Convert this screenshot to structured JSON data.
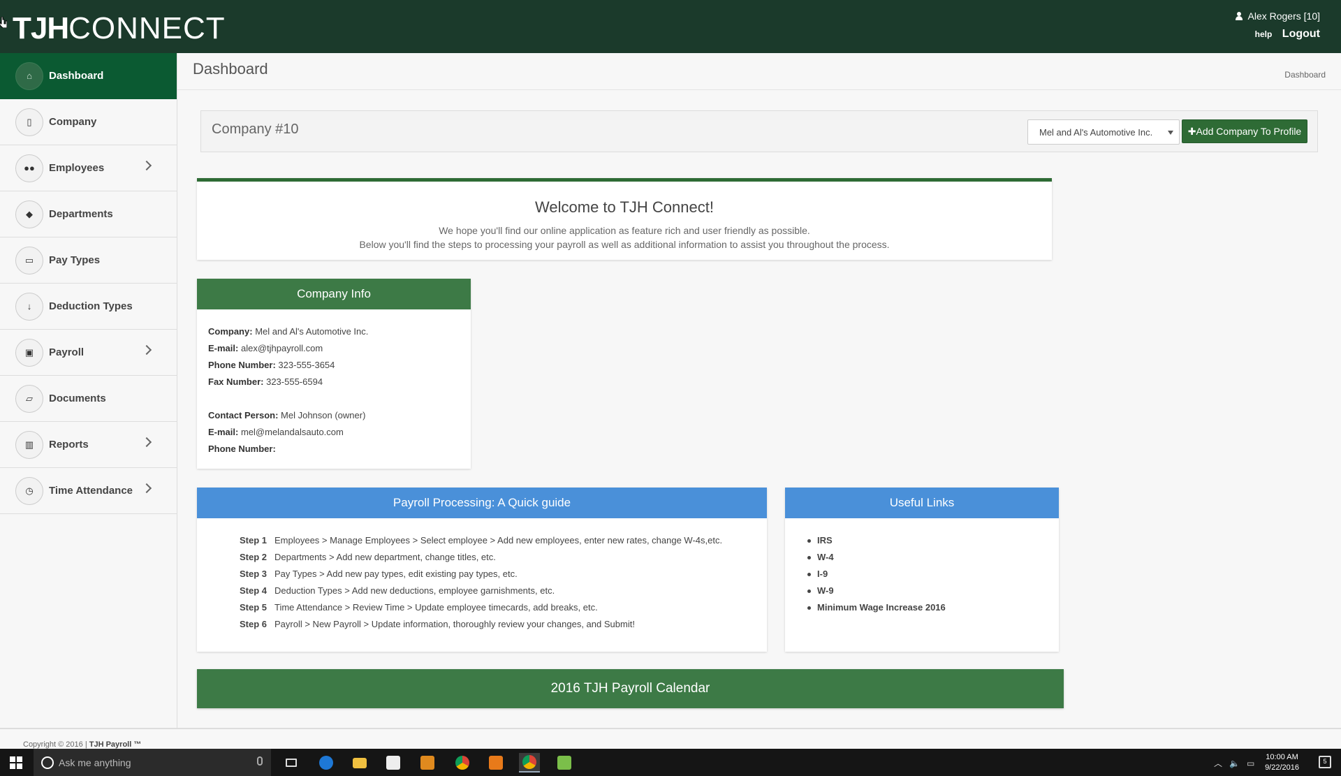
{
  "header": {
    "logo_bold": "TJH",
    "logo_light": "CONNECT",
    "user_name": "Alex Rogers [10]",
    "help_label": "help",
    "logout_label": "Logout"
  },
  "sidebar": {
    "items": [
      {
        "label": "Dashboard",
        "icon": "home-icon",
        "active": true
      },
      {
        "label": "Company",
        "icon": "building-icon"
      },
      {
        "label": "Employees",
        "icon": "users-icon",
        "has_submenu": true
      },
      {
        "label": "Departments",
        "icon": "tags-icon"
      },
      {
        "label": "Pay Types",
        "icon": "credit-card-icon"
      },
      {
        "label": "Deduction Types",
        "icon": "arrow-down-icon"
      },
      {
        "label": "Payroll",
        "icon": "money-icon",
        "has_submenu": true
      },
      {
        "label": "Documents",
        "icon": "folder-open-icon"
      },
      {
        "label": "Reports",
        "icon": "bar-chart-icon",
        "has_submenu": true
      },
      {
        "label": "Time Attendance",
        "icon": "clock-icon",
        "has_submenu": true
      }
    ]
  },
  "page": {
    "title": "Dashboard",
    "breadcrumb": "Dashboard"
  },
  "company_bar": {
    "title": "Company #10",
    "selected_company": "Mel and Al's Automotive Inc.",
    "add_button_label": "Add Company To Profile"
  },
  "welcome": {
    "heading": "Welcome to TJH Connect!",
    "line1": "We hope you'll find our online application as feature rich and user friendly as possible.",
    "line2": "Below you'll find the steps to processing your payroll as well as additional information to assist you throughout the process."
  },
  "company_info": {
    "title": "Company Info",
    "company_label": "Company:",
    "company_value": "Mel and Al's Automotive Inc.",
    "email_label": "E-mail:",
    "email_value": "alex@tjhpayroll.com",
    "phone_label": "Phone Number:",
    "phone_value": "323-555-3654",
    "fax_label": "Fax Number:",
    "fax_value": "323-555-6594",
    "contact_label": "Contact Person:",
    "contact_value": "Mel Johnson (owner)",
    "contact_email_label": "E-mail:",
    "contact_email_value": "mel@melandalsauto.com",
    "contact_phone_label": "Phone Number:",
    "contact_phone_value": ""
  },
  "guide": {
    "title": "Payroll Processing: A Quick guide",
    "steps": [
      {
        "step": "Step 1",
        "text": "Employees > Manage Employees > Select employee > Add new employees, enter new rates, change W-4s,etc."
      },
      {
        "step": "Step 2",
        "text": "Departments > Add new department, change titles, etc."
      },
      {
        "step": "Step 3",
        "text": "Pay Types > Add new pay types, edit existing pay types, etc."
      },
      {
        "step": "Step 4",
        "text": "Deduction Types > Add new deductions, employee garnishments, etc."
      },
      {
        "step": "Step 5",
        "text": "Time Attendance > Review Time > Update employee timecards, add breaks, etc."
      },
      {
        "step": "Step 6",
        "text": "Payroll > New Payroll > Update information, thoroughly review your changes, and Submit!"
      }
    ]
  },
  "useful_links": {
    "title": "Useful Links",
    "links": [
      "IRS",
      "W-4",
      "I-9",
      "W-9",
      "Minimum Wage Increase 2016"
    ]
  },
  "calendar": {
    "title": "2016 TJH Payroll Calendar"
  },
  "footer": {
    "copyright": "Copyright © 2016 |",
    "brand": "TJH Payroll ™"
  },
  "taskbar": {
    "search_placeholder": "Ask me anything",
    "time": "10:00 AM",
    "date": "9/22/2016",
    "notification_count": "5"
  },
  "colors": {
    "header_bg": "#1b3a2b",
    "active_nav": "#0b5a32",
    "accent_green": "#3d7a46",
    "accent_blue": "#4a90d9"
  }
}
